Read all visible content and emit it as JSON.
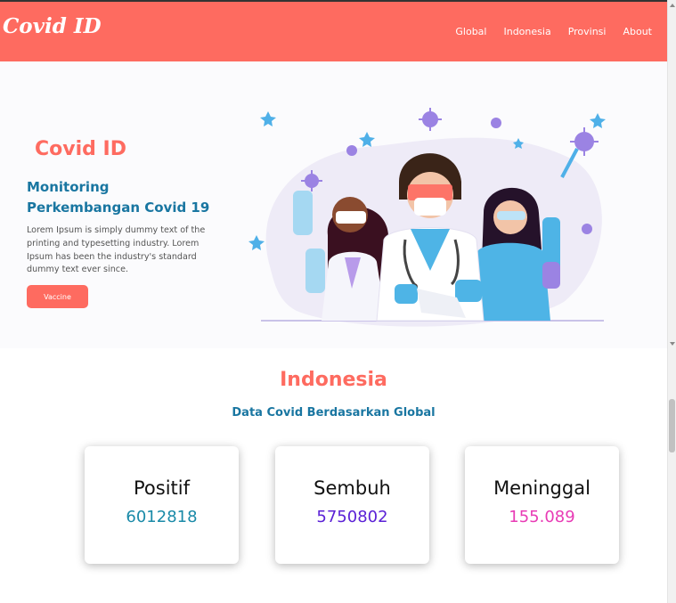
{
  "navbar": {
    "brand": "Covid ID",
    "links": [
      "Global",
      "Indonesia",
      "Provinsi",
      "About"
    ]
  },
  "hero": {
    "title": "Covid ID",
    "subtitle": "Monitoring Perkembangan Covid 19",
    "description": "Lorem Ipsum is simply dummy text of the printing and typesetting industry. Lorem Ipsum has been the industry's standard dummy text ever since.",
    "button_label": "Vaccine",
    "illustration_icon": "doctors-illustration"
  },
  "section": {
    "title": "Indonesia",
    "subtitle": "Data Covid Berdasarkan Global"
  },
  "stats": [
    {
      "label": "Positif",
      "value": "6012818",
      "color": "#1a8aa8"
    },
    {
      "label": "Sembuh",
      "value": "5750802",
      "color": "#5b21d6"
    },
    {
      "label": "Meninggal",
      "value": "155.089",
      "color": "#e83bb5"
    }
  ],
  "colors": {
    "primary": "#fe6b60",
    "accent_blue": "#1976a1"
  }
}
